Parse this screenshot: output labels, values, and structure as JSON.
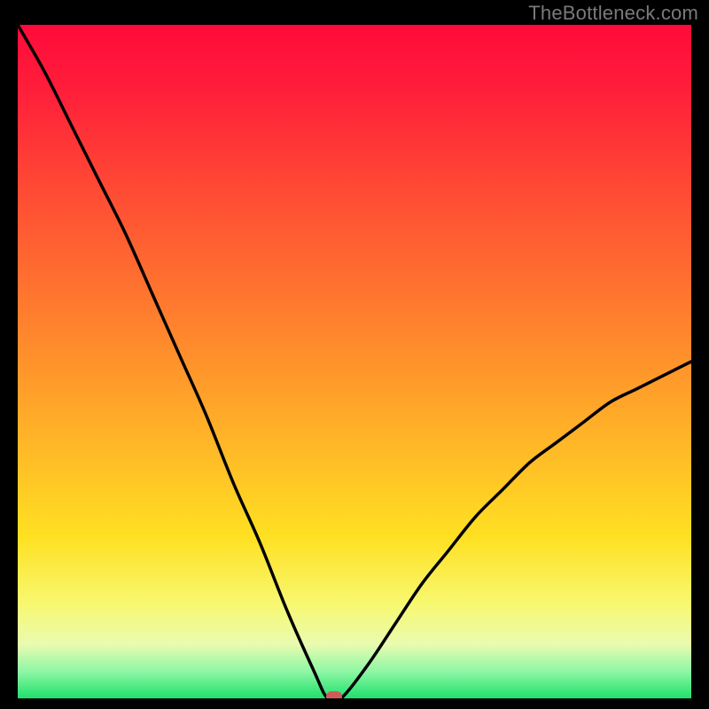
{
  "watermark": "TheBottleneck.com",
  "chart_data": {
    "type": "line",
    "title": "",
    "xlabel": "",
    "ylabel": "",
    "xlim": [
      0,
      100
    ],
    "ylim": [
      0,
      100
    ],
    "grid": false,
    "legend": false,
    "series": [
      {
        "name": "bottleneck-curve",
        "x": [
          0,
          4,
          8,
          12,
          16,
          20,
          24,
          28,
          32,
          36,
          40,
          44,
          46,
          48,
          52,
          56,
          60,
          64,
          68,
          72,
          76,
          80,
          84,
          88,
          92,
          96,
          100
        ],
        "values": [
          100,
          93,
          85,
          77,
          69,
          60,
          51,
          42,
          32,
          23,
          13,
          4,
          0,
          0,
          5,
          11,
          17,
          22,
          27,
          31,
          35,
          38,
          41,
          44,
          46,
          48,
          50
        ],
        "color": "#000000"
      }
    ],
    "marker": {
      "x": 47,
      "y": 0,
      "color": "#d05a5a"
    },
    "gradient": {
      "stops": [
        {
          "pos": 0.0,
          "color": "#ff0a3a"
        },
        {
          "pos": 0.1,
          "color": "#ff1f3a"
        },
        {
          "pos": 0.22,
          "color": "#ff4335"
        },
        {
          "pos": 0.36,
          "color": "#ff6a30"
        },
        {
          "pos": 0.5,
          "color": "#ff922b"
        },
        {
          "pos": 0.63,
          "color": "#ffb927"
        },
        {
          "pos": 0.76,
          "color": "#ffe022"
        },
        {
          "pos": 0.86,
          "color": "#f7f870"
        },
        {
          "pos": 0.92,
          "color": "#e9fbb0"
        },
        {
          "pos": 0.96,
          "color": "#8ef7a5"
        },
        {
          "pos": 1.0,
          "color": "#1fe06b"
        }
      ]
    }
  }
}
